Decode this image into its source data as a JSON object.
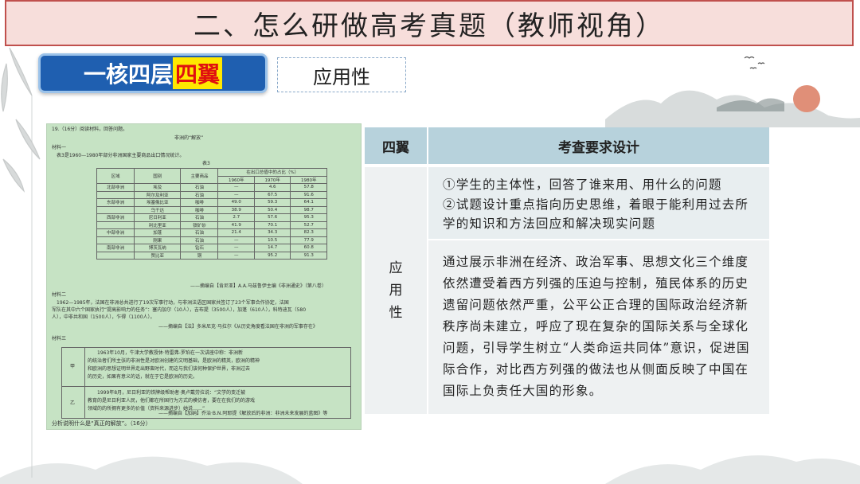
{
  "title": "二、怎么研做高考真题（教师视角）",
  "badge": {
    "main": "一核四层",
    "highlight": "四翼"
  },
  "label": "应用性",
  "table": {
    "header": {
      "col1": "四翼",
      "col2": "考查要求设计"
    },
    "row_label": "应用性",
    "point1": "①学生的主体性，回答了谁来用、用什么的问题",
    "point2": "②试题设计重点指向历史思维，着眼于能利用过去所学的知识和方法回应和解决现实问题",
    "paragraph": "通过展示非洲在经济、政治军事、思想文化三个维度依然遭受着西方列强的压迫与控制，殖民体系的历史遗留问题依然严重，公平公正合理的国际政治经济新秩序尚未建立，呼应了现在复杂的国际关系与全球化问题，引导学生树立“人类命运共同体”意识，促进国际合作，对比西方列强的做法也从侧面反映了中国在国际上负责任大国的形象。"
  },
  "paper": {
    "q": "19.（16分）阅读材料，回答问题。",
    "heading": "非洲的“解放”",
    "m1": "材料一",
    "m1_text": "表3是1960—1980年部分非洲国家主要商品出口情况统计。",
    "table_caption": "表3",
    "table_header": [
      "区域",
      "国别",
      "主要商品",
      "在出口总值中的占比（%）"
    ],
    "years": [
      "1960年",
      "1970年",
      "1980年"
    ],
    "rows": [
      [
        "北部非洲",
        "埃及",
        "石油",
        "—",
        "4.6",
        "57.8"
      ],
      [
        "",
        "阿尔及利亚",
        "石油",
        "—",
        "67.5",
        "91.6"
      ],
      [
        "东部非洲",
        "埃塞俄比亚",
        "咖啡",
        "49.0",
        "59.3",
        "64.1"
      ],
      [
        "",
        "乌干达",
        "咖啡",
        "38.9",
        "50.4",
        "98.7"
      ],
      [
        "西部非洲",
        "尼日利亚",
        "石油",
        "2.7",
        "57.6",
        "95.3"
      ],
      [
        "",
        "利比里亚",
        "铁矿砂",
        "41.9",
        "70.1",
        "52.7"
      ],
      [
        "中部非洲",
        "加蓬",
        "石油",
        "21.4",
        "34.3",
        "82.3"
      ],
      [
        "",
        "刚果",
        "石油",
        "—",
        "10.5",
        "77.9"
      ],
      [
        "南部非洲",
        "博茨瓦纳",
        "钻石",
        "—",
        "14.7",
        "60.8"
      ],
      [
        "",
        "赞比亚",
        "铜",
        "—",
        "95.2",
        "91.3"
      ]
    ],
    "src1": "——摘编自【肯尼亚】A.A.马兹鲁伊主编《非洲通史》（第八卷）",
    "m2": "材料二",
    "m2_l1": "1962—1985年，法国在非洲总共进行了19次军事行动，与非洲法语区国家共签订了23个军事合作协定，法国",
    "m2_l2": "军队在其中六个国家执行“提高影响力的任务”：塞内加尔（10人），吉布提（3500人），加蓬（610人），科特迪瓦（580",
    "m2_l3": "人），中非共和国（1500人），乍得（1100人）。",
    "src2": "——摘编自【法】多米尼克·马拉尔《从历史角度看法国在非洲的军事存在》",
    "m3": "材料三",
    "m3_a1": "1963年10月，牛津大学教授休·特雷弗-罗珀在一次讲座中称：非洲新",
    "m3_a2": "的统治者们所主张的非洲性是对欧洲创建的文明基础，是欧洲的精英，欧洲的精神",
    "m3_a3": "和欧洲的思想证明世界走出野蛮时代，而这与我们该何种保护世界，非洲过去",
    "m3_a4": "的历史，如果有意义的话，就在于它是欧洲的历史。",
    "m3_jia": "甲",
    "m3_b1": "1999年8月，尼日利亚的铁牌级帮助者·奥卢戴劳拉说：“文学的变迁被",
    "m3_b2": "教育的是尼日利亚人民，他们都在所国行为方式的模仿者，要在在我们的的游戏",
    "m3_b3": "领域的的所拥有更多的价值（资料来源进步）她说……”",
    "m3_yi": "乙",
    "src3": "——摘编自【加纳】乔治·B.N.阿耶提《解放后的非洲：非洲未来发展的蓝图》等",
    "ask": "分析说明什么是“真正的解放”。（16分）"
  }
}
